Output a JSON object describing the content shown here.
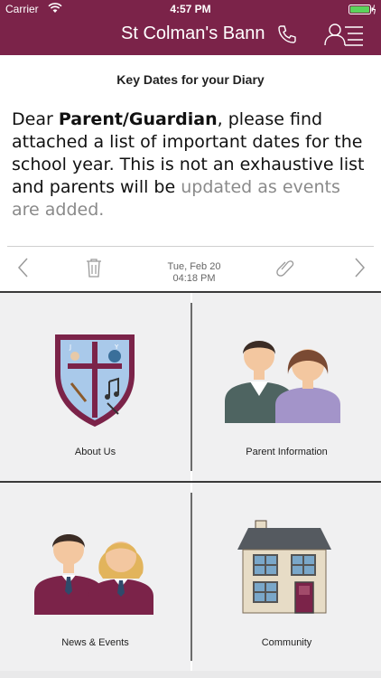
{
  "status_bar": {
    "carrier": "Carrier",
    "time": "4:57 PM"
  },
  "header": {
    "title": "St Colman's Bann",
    "brand_color": "#7b2349"
  },
  "message": {
    "title": "Key Dates for your Diary",
    "greeting": "Dear ",
    "greeting_bold": "Parent/Guardian",
    "body_main": ", please find attached a list of important dates for the school year. This is not an exhaustive list and parents will be",
    "body_faded": "updated as events are added."
  },
  "toolbar": {
    "date": "Tue, Feb 20",
    "time": "04:18 PM"
  },
  "tiles": [
    {
      "label": "About Us",
      "icon": "school-crest-icon"
    },
    {
      "label": "Parent Information",
      "icon": "parents-icon"
    },
    {
      "label": "News & Events",
      "icon": "students-icon"
    },
    {
      "label": "Community",
      "icon": "house-icon"
    }
  ]
}
